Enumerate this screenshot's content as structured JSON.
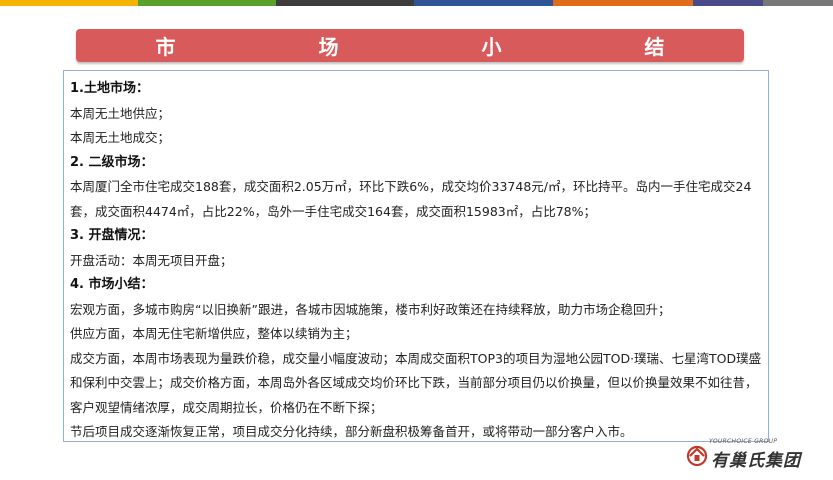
{
  "header": {
    "title": "市 场 小 结",
    "stripe_colors": [
      "#f4b400",
      "#5aa02c",
      "#3d3d3d",
      "#2f5597",
      "#e06c1b",
      "#4a4a8a",
      "#777777"
    ]
  },
  "content": {
    "s1_heading": "1.土地市场：",
    "s1_line1": "本周无土地供应；",
    "s1_line2": "本周无土地成交；",
    "s2_heading": "2. 二级市场：",
    "s2_para": "本周厦门全市住宅成交188套，成交面积2.05万㎡，环比下跌6%，成交均价33748元/㎡，环比持平。岛内一手住宅成交24套，成交面积4474㎡，占比22%，岛外一手住宅成交164套，成交面积15983㎡，占比78%；",
    "s3_heading": "3. 开盘情况：",
    "s3_line": "开盘活动：本周无项目开盘；",
    "s4_heading": "4. 市场小结：",
    "s4_p1": "宏观方面，多城市购房“以旧换新”跟进，各城市因城施策，楼市利好政策还在持续释放，助力市场企稳回升；",
    "s4_p2": "供应方面，本周无住宅新增供应，整体以续销为主；",
    "s4_p3": "成交方面，本周市场表现为量跌价稳，成交量小幅度波动；本周成交面积TOP3的项目为湿地公园TOD·璞瑞、七星湾TOD璞盛和保利中交雲上；成交价格方面，本周岛外各区域成交均价环比下跌，当前部分项目仍以价换量，但以价换量效果不如往昔，客户观望情绪浓厚，成交周期拉长，价格仍在不断下探；",
    "s4_p4": "节后项目成交逐渐恢复正常，项目成交分化持续，部分新盘积极筹备首开，或将带动一部分客户入市。"
  },
  "logo": {
    "english": "YOURCHOICE GROUP",
    "chinese": "有巢氏集团",
    "icon": "house-logo-icon",
    "color": "#c0392b"
  }
}
